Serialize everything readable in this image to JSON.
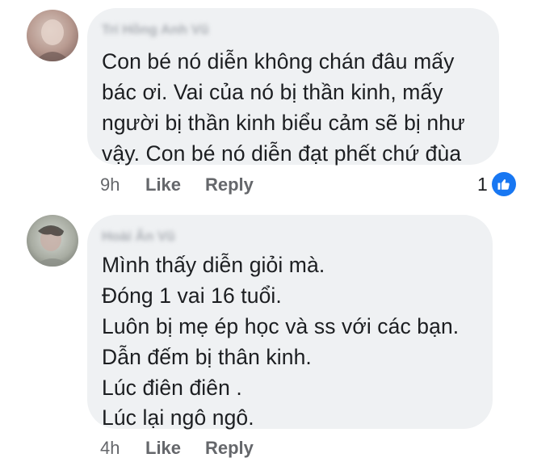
{
  "comments": [
    {
      "author": "Trí Hồng Anh Vũ",
      "lines": [
        "Con bé nó diễn không chán đâu mấy",
        "bác ơi. Vai của nó bị thần kinh, mấy",
        "người bị thần kinh biểu cảm sẽ bị như",
        "vậy. Con bé nó diễn đạt phết chứ đùa"
      ],
      "time": "9h",
      "like_label": "Like",
      "reply_label": "Reply",
      "reaction_count": "1",
      "reaction_icon": "thumbs-up-icon",
      "reaction_color": "#1877f2"
    },
    {
      "author": "Hoài Ân Vũ",
      "lines": [
        "Mình thấy diễn giỏi mà.",
        "Đóng 1 vai 16 tuổi.",
        "Luôn bị mẹ ép học và ss với các bạn.",
        "Dẫn đếm bị thân kinh.",
        "Lúc điên điên .",
        "Lúc lại ngô ngô."
      ],
      "time": "4h",
      "like_label": "Like",
      "reply_label": "Reply"
    }
  ],
  "colors": {
    "bubble": "#eff1f3",
    "text": "#1c1e21",
    "meta": "#65676b",
    "accent": "#1877f2"
  }
}
